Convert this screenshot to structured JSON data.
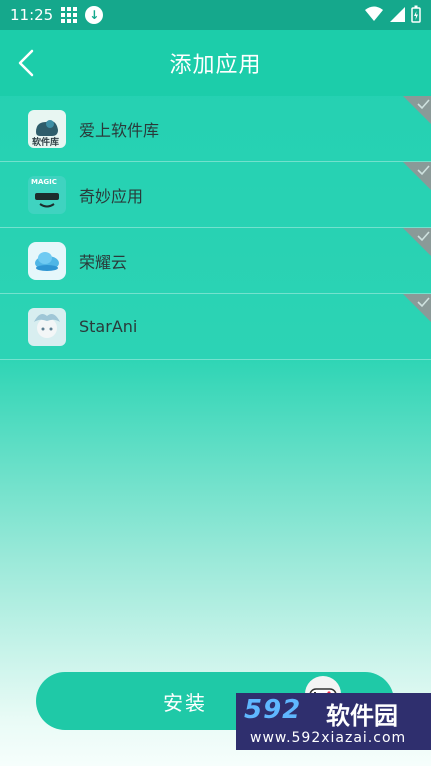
{
  "statusbar": {
    "time": "11:25"
  },
  "header": {
    "title": "添加应用"
  },
  "apps": [
    {
      "name": "爱上软件库",
      "icon": "aishang-app-icon",
      "icon_caption": "软件库"
    },
    {
      "name": "奇妙应用",
      "icon": "qimiao-app-icon",
      "icon_caption": "MAGIC"
    },
    {
      "name": "荣耀云",
      "icon": "rongyao-cloud-icon"
    },
    {
      "name": "StarAni",
      "icon": "starani-app-icon"
    }
  ],
  "install": {
    "label": "安装"
  },
  "watermark": {
    "brand": "592",
    "brand_cn": "软件园",
    "url": "www.592xiazai.com"
  },
  "colors": {
    "accent": "#1ccdaa",
    "statusbar": "#15a88c",
    "text": "#2a3a3a"
  }
}
